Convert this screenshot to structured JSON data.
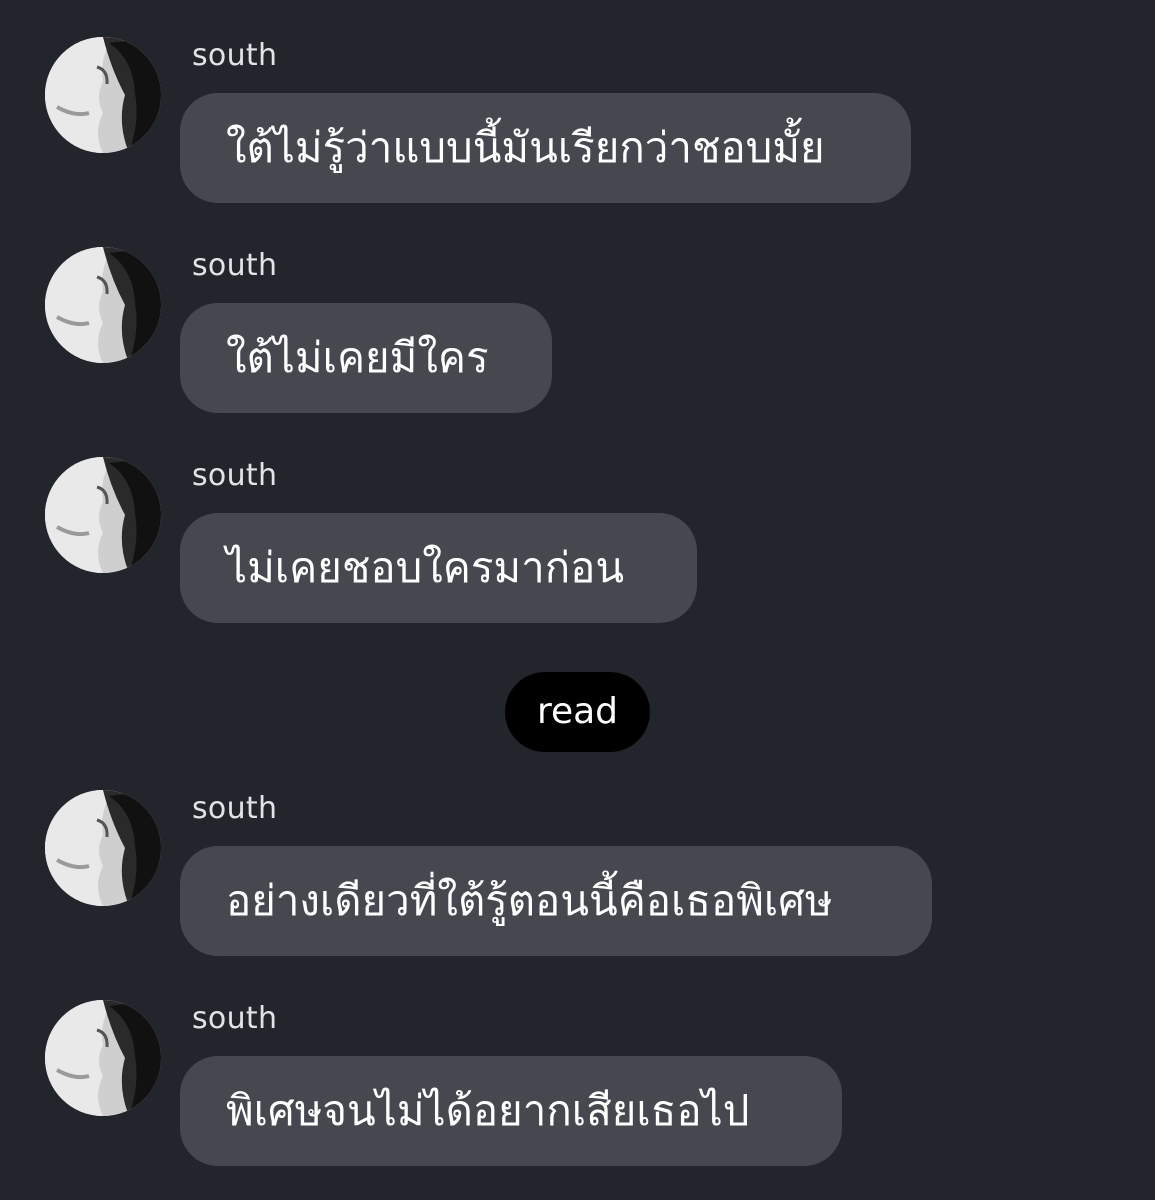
{
  "chat": {
    "messages": [
      {
        "sender": "south",
        "text": "ใต้ไม่รู้ว่าแบบนี้มันเรียกว่าชอบมั้ย"
      },
      {
        "sender": "south",
        "text": "ใต้ไม่เคยมีใคร"
      },
      {
        "sender": "south",
        "text": "ไม่เคยชอบใครมาก่อน"
      },
      {
        "sender": "south",
        "text": "อย่างเดียวที่ใต้รู้ตอนนี้คือเธอพิเศษ"
      },
      {
        "sender": "south",
        "text": "พิเศษจนไม่ได้อยากเสียเธอไป"
      }
    ],
    "read_label": "read"
  },
  "colors": {
    "background": "#23252c",
    "bubble": "#464850",
    "read_pill": "#000000",
    "text": "#ffffff"
  }
}
